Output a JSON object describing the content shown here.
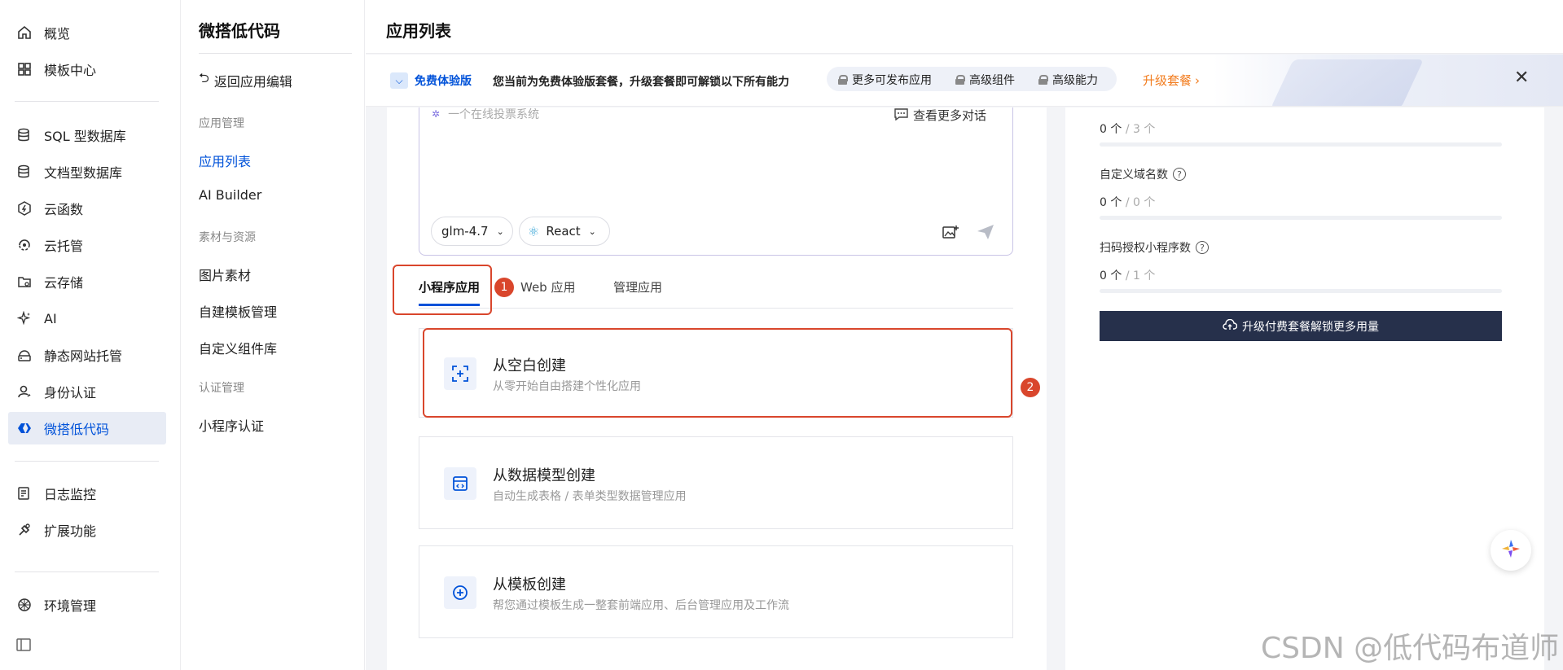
{
  "nav": {
    "items": [
      {
        "label": "概览",
        "icon": "home-icon"
      },
      {
        "label": "模板中心",
        "icon": "grid-icon"
      },
      {
        "label": "SQL 型数据库",
        "icon": "database-icon"
      },
      {
        "label": "文档型数据库",
        "icon": "document-database-icon"
      },
      {
        "label": "云函数",
        "icon": "function-icon"
      },
      {
        "label": "云托管",
        "icon": "cloud-run-icon"
      },
      {
        "label": "云存储",
        "icon": "storage-icon"
      },
      {
        "label": "AI",
        "icon": "sparkle-icon"
      },
      {
        "label": "静态网站托管",
        "icon": "website-icon"
      },
      {
        "label": "身份认证",
        "icon": "user-auth-icon"
      },
      {
        "label": "微搭低代码",
        "icon": "lowcode-icon",
        "active": true
      },
      {
        "label": "日志监控",
        "icon": "log-icon"
      },
      {
        "label": "扩展功能",
        "icon": "extension-icon"
      },
      {
        "label": "环境管理",
        "icon": "environment-icon"
      }
    ],
    "accent": "#0052d9"
  },
  "subnav": {
    "title": "微搭低代码",
    "back": "返回应用编辑",
    "group1": "应用管理",
    "app_list": "应用列表",
    "ai_builder": "AI Builder",
    "group2": "素材与资源",
    "images": "图片素材",
    "custom_templates": "自建模板管理",
    "custom_components": "自定义组件库",
    "group3": "认证管理",
    "mini_auth": "小程序认证"
  },
  "header": {
    "title": "应用列表"
  },
  "banner": {
    "plan_label": "免费体验版",
    "message": "您当前为免费体验版套餐，升级套餐即可解锁以下所有能力",
    "features": [
      "更多可发布应用",
      "高级组件",
      "高级能力"
    ],
    "upgrade": "升级套餐"
  },
  "chat": {
    "placeholder": "一个在线投票系统",
    "more": "查看更多对话",
    "model": "glm-4.7",
    "framework": "React"
  },
  "tabs": [
    "小程序应用",
    "Web 应用",
    "管理应用"
  ],
  "cards": [
    {
      "title": "从空白创建",
      "desc": "从零开始自由搭建个性化应用"
    },
    {
      "title": "从数据模型创建",
      "desc": "自动生成表格 / 表单类型数据管理应用"
    },
    {
      "title": "从模板创建",
      "desc": "帮您通过模板生成一整套前端应用、后台管理应用及工作流"
    }
  ],
  "annotations": [
    "1",
    "2"
  ],
  "stats": [
    {
      "label": "",
      "used": "0 个",
      "total": "/ 3 个",
      "fraction": 0
    },
    {
      "label": "自定义域名数",
      "used": "0 个",
      "total": "/ 0 个",
      "fraction": 0
    },
    {
      "label": "扫码授权小程序数",
      "used": "0 个",
      "total": "/ 1 个",
      "fraction": 0
    }
  ],
  "upgrade_button": "升级付费套餐解锁更多用量",
  "watermark": "CSDN @低代码布道师"
}
